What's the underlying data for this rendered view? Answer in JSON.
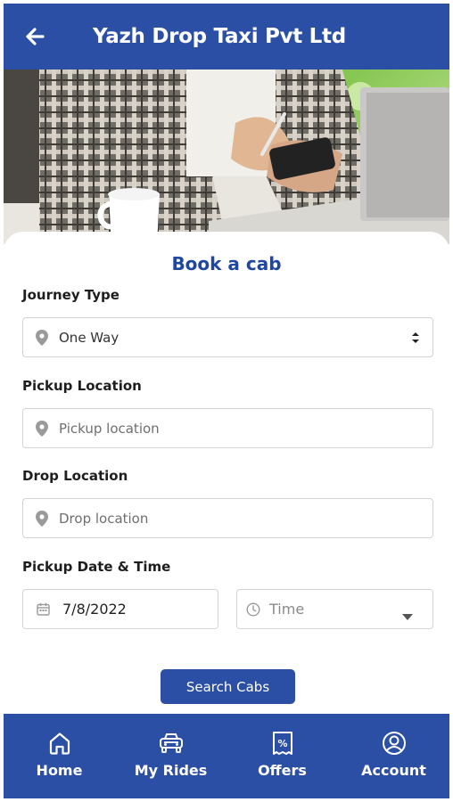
{
  "header": {
    "title": "Yazh Drop Taxi Pvt Ltd",
    "back_icon": "arrow-left-icon"
  },
  "colors": {
    "primary": "#2a4fa5",
    "title_blue": "#1f47a0",
    "border": "#d4d4d4"
  },
  "form": {
    "title": "Book a cab",
    "journey_type": {
      "label": "Journey Type",
      "value": "One Way"
    },
    "pickup": {
      "label": "Pickup Location",
      "placeholder": "Pickup location"
    },
    "drop": {
      "label": "Drop Location",
      "placeholder": "Drop location"
    },
    "datetime": {
      "label": "Pickup Date & Time",
      "date": "7/8/2022",
      "time_placeholder": "Time"
    },
    "search_button": "Search Cabs"
  },
  "nav": [
    {
      "label": "Home",
      "icon": "home-icon"
    },
    {
      "label": "My Rides",
      "icon": "car-icon"
    },
    {
      "label": "Offers",
      "icon": "offer-icon"
    },
    {
      "label": "Account",
      "icon": "account-icon"
    }
  ]
}
